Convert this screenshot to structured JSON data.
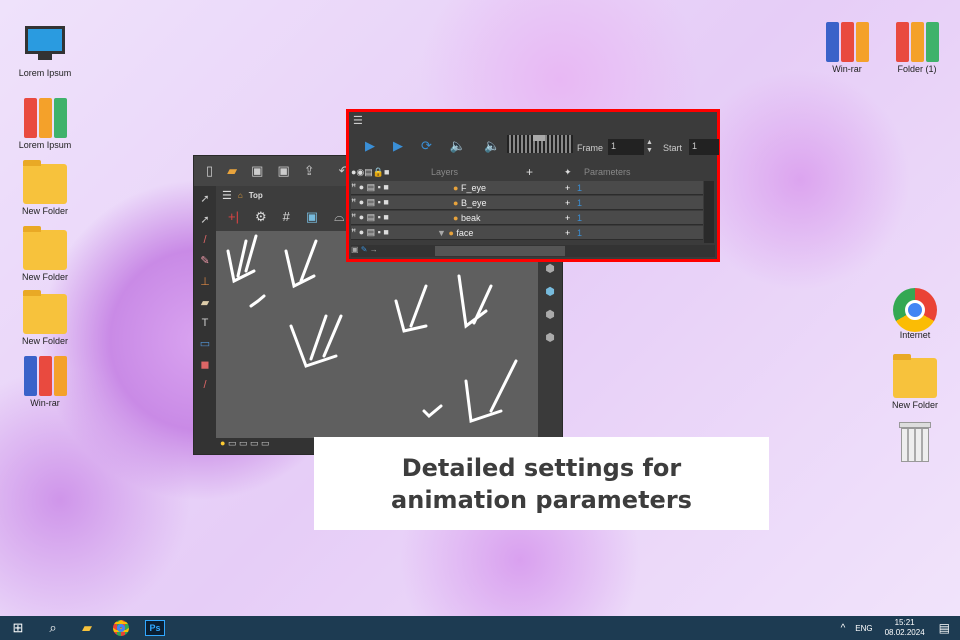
{
  "desktop_left": [
    {
      "label": "Lorem Ipsum",
      "icon": "computer-icon"
    },
    {
      "label": "Lorem Ipsum",
      "icon": "binders-icon"
    },
    {
      "label": "New Folder",
      "icon": "folder-icon"
    },
    {
      "label": "New Folder",
      "icon": "folder-icon"
    },
    {
      "label": "New Folder",
      "icon": "folder-icon"
    },
    {
      "label": "Win-rar",
      "icon": "winrar-icon"
    }
  ],
  "desktop_right": [
    {
      "label": "Win-rar",
      "icon": "winrar-icon"
    },
    {
      "label": "Folder (1)",
      "icon": "binders-icon"
    },
    {
      "label": "Internet",
      "icon": "chrome-icon"
    },
    {
      "label": "New Folder",
      "icon": "folder-icon"
    },
    {
      "label": "",
      "icon": "trash-icon"
    }
  ],
  "editor": {
    "breadcrumb": "Top"
  },
  "panel": {
    "frame_label": "Frame",
    "frame_value": "1",
    "start_label": "Start",
    "start_value": "1",
    "layers_header": "Layers",
    "parameters_header": "Parameters",
    "layers": [
      {
        "name": "F_eye",
        "param": "1"
      },
      {
        "name": "B_eye",
        "param": "1"
      },
      {
        "name": "beak",
        "param": "1"
      },
      {
        "name": "face",
        "param": "1"
      }
    ]
  },
  "caption": {
    "line1": "Detailed settings for",
    "line2": "animation parameters"
  },
  "taskbar": {
    "lang": "ENG",
    "time": "15:21",
    "date": "08.02.2024",
    "ps_label": "Ps"
  }
}
